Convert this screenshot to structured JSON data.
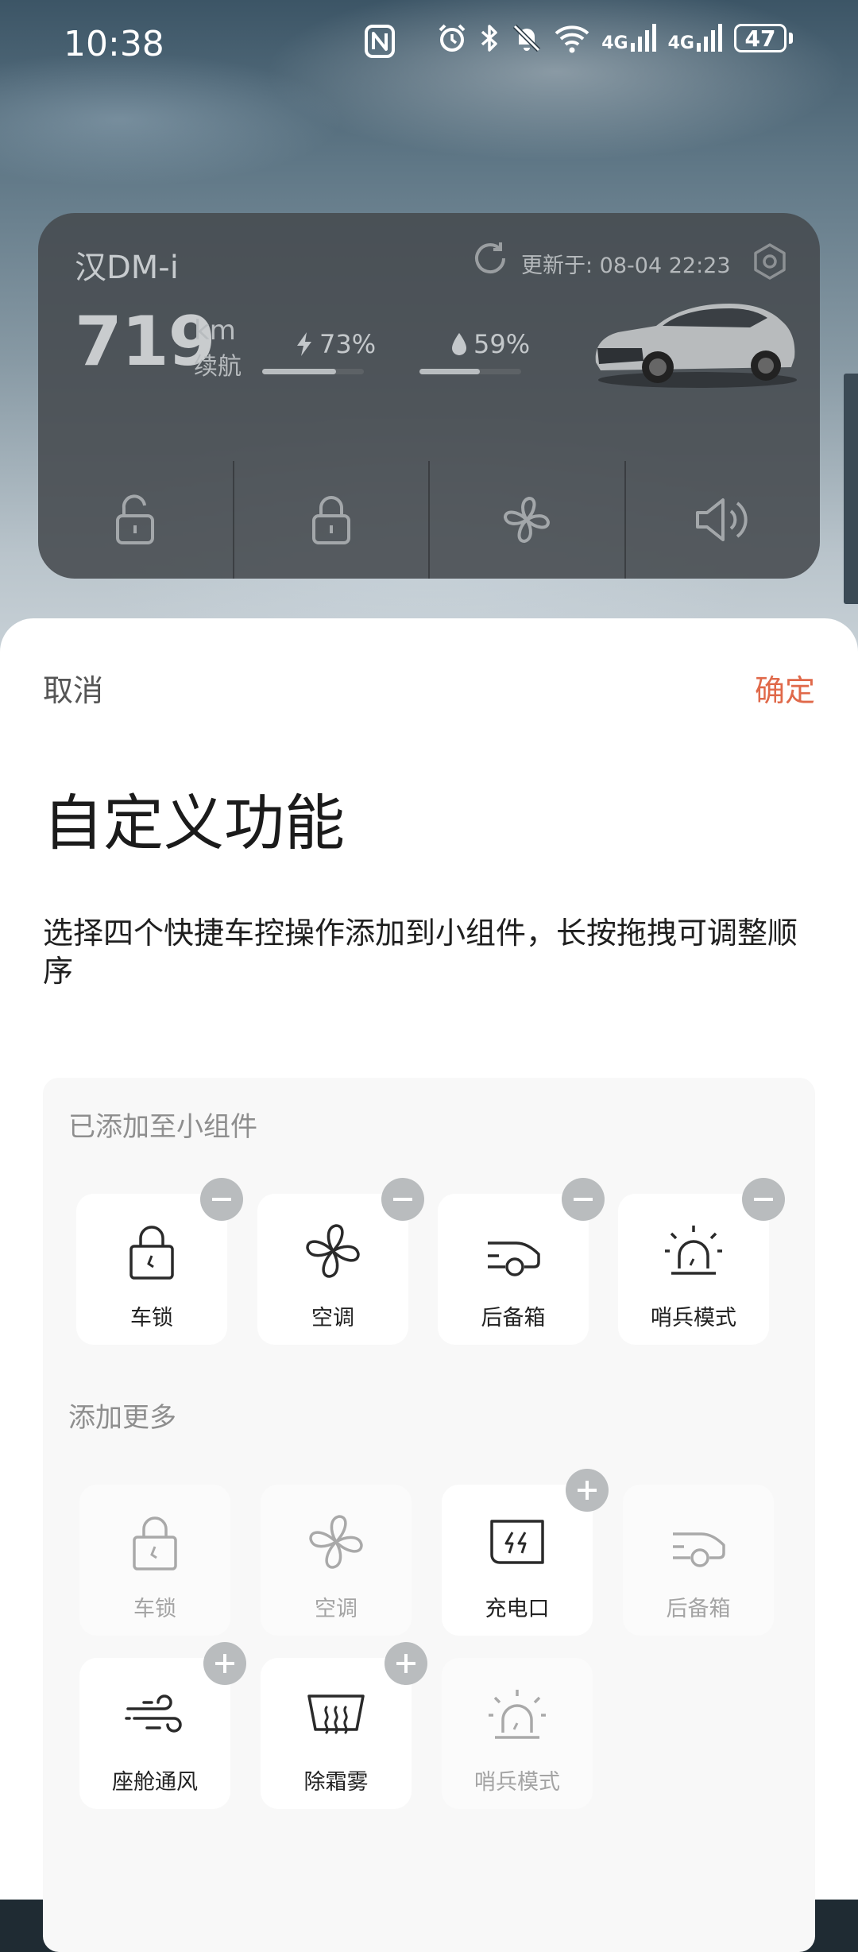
{
  "status_bar": {
    "time": "10:38",
    "network_1": "4G",
    "network_2": "4G",
    "battery": "47",
    "icons": [
      "nfc-icon",
      "alarm-icon",
      "bluetooth-icon",
      "mute-icon",
      "wifi-icon",
      "signal-icon",
      "signal-icon",
      "battery-icon"
    ]
  },
  "widget": {
    "car_name": "汉DM-i",
    "updated": "更新于:  08-04 22:23",
    "range_value": "719",
    "range_unit": "km",
    "range_label": "续航",
    "battery_pct": "73%",
    "battery_level": 0.73,
    "fuel_pct": "59%",
    "fuel_level": 0.59,
    "quick_actions": [
      "unlock-icon",
      "lock-icon",
      "fan-icon",
      "horn-icon"
    ]
  },
  "sheet": {
    "cancel": "取消",
    "confirm": "确定",
    "title": "自定义功能",
    "description": "选择四个快捷车控操作添加到小组件，长按拖拽可调整顺序",
    "added_section": "已添加至小组件",
    "more_section": "添加更多",
    "added_items": [
      {
        "label": "车锁",
        "icon": "lock-icon"
      },
      {
        "label": "空调",
        "icon": "fan-icon"
      },
      {
        "label": "后备箱",
        "icon": "trunk-icon"
      },
      {
        "label": "哨兵模式",
        "icon": "sentry-icon"
      }
    ],
    "more_items": [
      {
        "label": "车锁",
        "icon": "lock-icon",
        "enabled": false
      },
      {
        "label": "空调",
        "icon": "fan-icon",
        "enabled": false
      },
      {
        "label": "充电口",
        "icon": "charge-port-icon",
        "enabled": true
      },
      {
        "label": "后备箱",
        "icon": "trunk-icon",
        "enabled": false
      },
      {
        "label": "座舱通风",
        "icon": "ventilation-icon",
        "enabled": true
      },
      {
        "label": "除霜雾",
        "icon": "defrost-icon",
        "enabled": true
      },
      {
        "label": "哨兵模式",
        "icon": "sentry-icon",
        "enabled": false
      }
    ]
  },
  "colors": {
    "accent": "#e0694a",
    "badge": "#b9bcbe",
    "panel": "#f8f8f8"
  }
}
